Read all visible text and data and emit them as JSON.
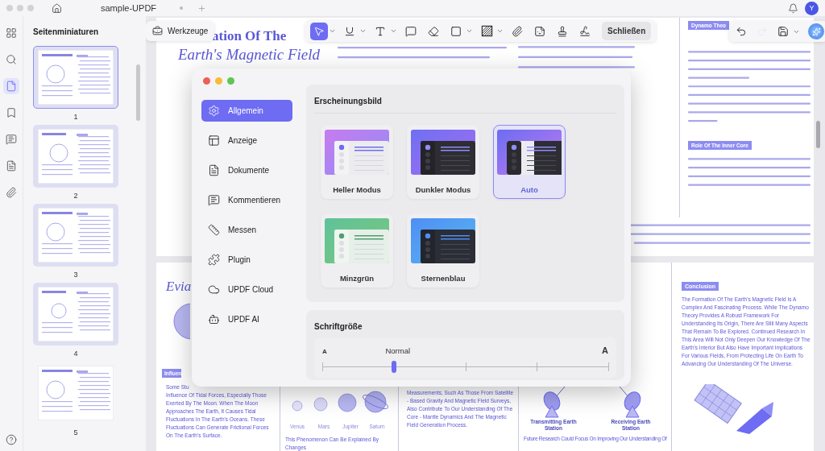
{
  "titlebar": {
    "tab_title": "sample-UPDF",
    "modified": true,
    "avatar": "Y"
  },
  "left_rail": [
    {
      "kind": "pages",
      "selected": false
    },
    {
      "kind": "search",
      "selected": false
    },
    {
      "kind": "thumbnails",
      "selected": true
    },
    {
      "kind": "bookmarks",
      "selected": false
    },
    {
      "kind": "comments",
      "selected": false
    },
    {
      "kind": "document",
      "selected": false
    },
    {
      "kind": "attachments",
      "selected": false
    },
    {
      "kind": "help",
      "selected": false
    }
  ],
  "thumbnails": {
    "title": "Seitenminiaturen",
    "pages": [
      {
        "number": "1",
        "selected": true,
        "highlighted": true
      },
      {
        "number": "2",
        "selected": false,
        "highlighted": true
      },
      {
        "number": "3",
        "selected": false,
        "highlighted": true
      },
      {
        "number": "4",
        "selected": false,
        "highlighted": true
      },
      {
        "number": "5",
        "selected": false,
        "highlighted": false
      }
    ]
  },
  "tools_button": "Werkzeuge",
  "toolbar": {
    "tools": [
      {
        "kind": "select",
        "selected": true,
        "menu": true
      },
      {
        "kind": "text-underline",
        "selected": false,
        "menu": true
      },
      {
        "kind": "text",
        "selected": false,
        "menu": true
      },
      {
        "kind": "comment",
        "selected": false,
        "menu": false
      },
      {
        "kind": "eraser",
        "selected": false,
        "menu": false
      },
      {
        "kind": "shape",
        "selected": false,
        "menu": true
      },
      {
        "kind": "hatch",
        "selected": false,
        "menu": true
      },
      {
        "kind": "attach",
        "selected": false,
        "menu": false
      },
      {
        "kind": "sticker",
        "selected": false,
        "menu": false
      },
      {
        "kind": "stamp",
        "selected": false,
        "menu": false
      },
      {
        "kind": "signature",
        "selected": false,
        "menu": false
      }
    ],
    "close": "Schließen"
  },
  "history_toolbar": [
    {
      "kind": "undo",
      "disabled": false
    },
    {
      "kind": "redo",
      "disabled": true
    },
    {
      "kind": "save",
      "disabled": false
    }
  ],
  "document": {
    "page_1": {
      "title_lines": [
        "ation Of The",
        "Earth's Magnetic Field"
      ],
      "dynamo_heading": "Dynamo Theo",
      "inner_core_heading": "Role Of The Inner Core"
    },
    "page_2": {
      "title": "Evia",
      "tidal": {
        "heading": "Influen",
        "cut_line": "Some Stu",
        "paragraph": "Influence Of Tidal Forces, Especially Those Exerted By The Moon. When The Moon Approaches The Earth, It Causes Tidal Fluctuations In The Earth's Oceans. These Fluctuations Can Generate Frictional Forces On The Earth's Surface."
      },
      "planets": {
        "labels": [
          "Venus",
          "Mars",
          "Jupiter",
          "Saturn"
        ],
        "caption": "This Phenomenon Can Be Explained By Changes"
      },
      "measurements": "Measurements, Such As Those From Satellite - Based Gravity And Magnetic Field Surveys, Also Contribute To Our Understanding Of The Core - Mantle Dynamics And The Magnetic Field Generation Process.",
      "stations": {
        "labels": [
          "Transmitting Earth Station",
          "Receiving Earth Station"
        ],
        "caption": "Future Research Could Focus On Improving Our Understanding Of"
      },
      "conclusion": {
        "heading": "Conclusion",
        "paragraph": "The Formation Of The Earth's Magnetic Field Is A Complex And Fascinating Process. While The Dynamo Theory Provides A Robust Framework For Understanding Its Origin, There Are Still Many Aspects That Remain To Be Explored. Continued Research In This Area Will Not Only Deepen Our Knowledge Of The Earth's Interior But Also Have Important Implications For Various Fields, From Protecting Life On Earth To Advancing Our Understanding Of The Universe."
      }
    }
  },
  "dialog": {
    "nav": [
      {
        "kind": "general",
        "label": "Allgemein",
        "selected": true
      },
      {
        "kind": "display",
        "label": "Anzeige",
        "selected": false
      },
      {
        "kind": "documents",
        "label": "Dokumente",
        "selected": false
      },
      {
        "kind": "comment",
        "label": "Kommentieren",
        "selected": false
      },
      {
        "kind": "measure",
        "label": "Messen",
        "selected": false
      },
      {
        "kind": "plugin",
        "label": "Plugin",
        "selected": false
      },
      {
        "kind": "cloud",
        "label": "UPDF Cloud",
        "selected": false
      },
      {
        "kind": "ai",
        "label": "UPDF AI",
        "selected": false
      }
    ],
    "appearance": {
      "title": "Erscheinungsbild",
      "themes": [
        {
          "kind": "light",
          "label": "Heller Modus",
          "selected": false
        },
        {
          "kind": "dark",
          "label": "Dunkler Modus",
          "selected": false
        },
        {
          "kind": "auto",
          "label": "Auto",
          "selected": true
        },
        {
          "kind": "mint",
          "label": "Minzgrün",
          "selected": false
        },
        {
          "kind": "starblue",
          "label": "Sternenblau",
          "selected": false
        }
      ]
    },
    "font_size": {
      "title": "Schriftgröße",
      "small_label": "A",
      "large_label": "A",
      "current": "Normal",
      "level": 0.25
    }
  }
}
